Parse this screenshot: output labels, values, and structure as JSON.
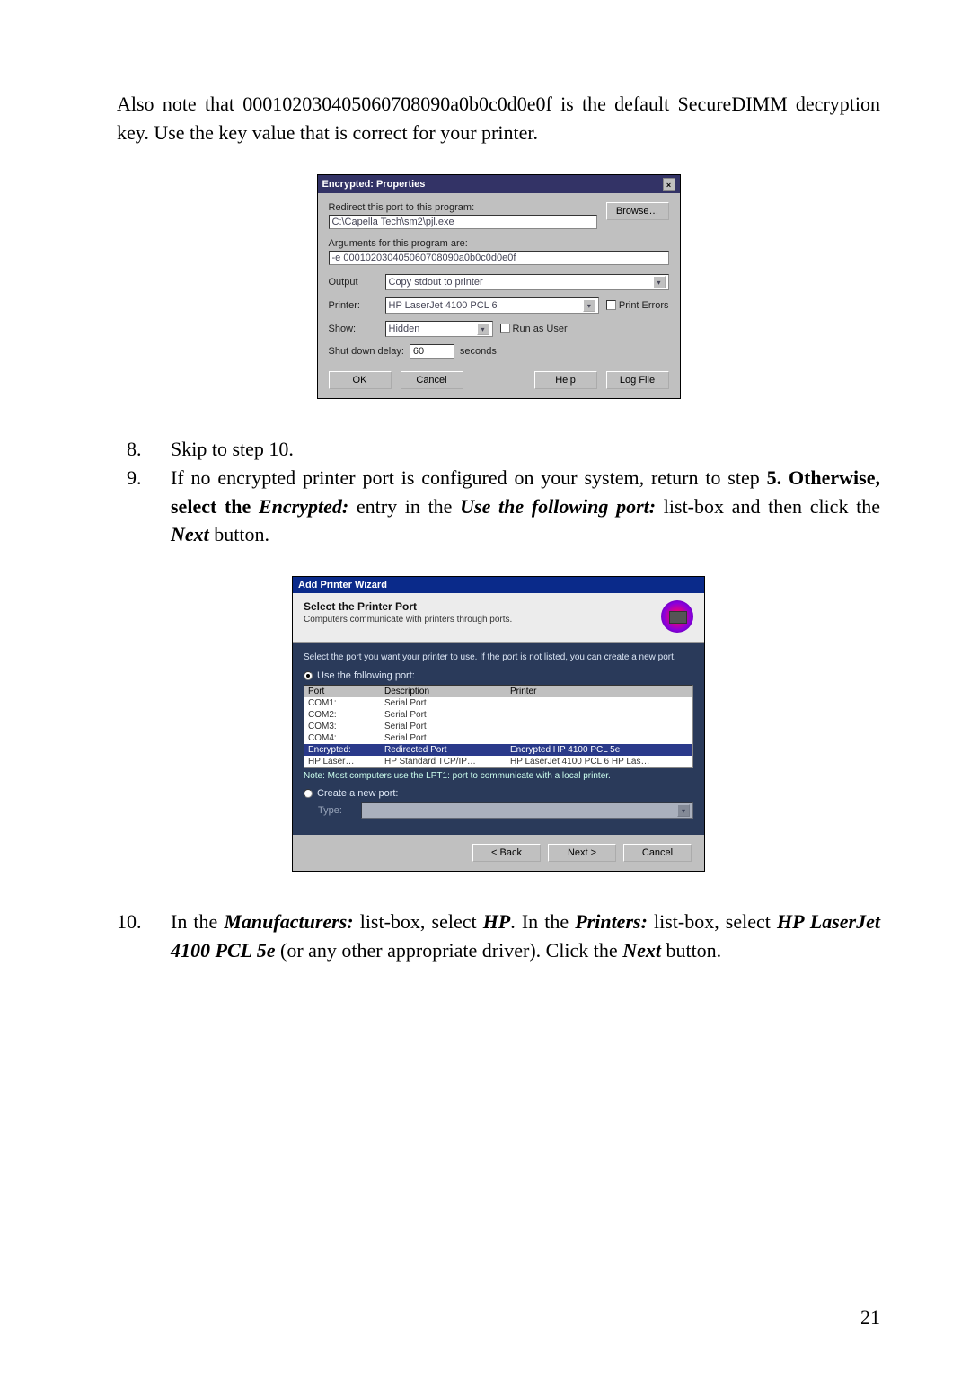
{
  "intro": "Also note that 000102030405060708090a0b0c0d0e0f is the default SecureDIMM decryption key.  Use the key value that is correct for your printer.",
  "dialog1": {
    "title": "Encrypted: Properties",
    "close": "×",
    "redirect_label": "Redirect this port to this program:",
    "redirect_value": "C:\\Capella Tech\\sm2\\pjl.exe",
    "browse": "Browse…",
    "arguments_label": "Arguments for this program are:",
    "arguments_value": "-e 000102030405060708090a0b0c0d0e0f",
    "output_label": "Output",
    "output_value": "Copy stdout to printer",
    "printer_label": "Printer:",
    "printer_value": "HP LaserJet 4100 PCL 6",
    "print_errors_label": "Print Errors",
    "show_label": "Show:",
    "show_value": "Hidden",
    "run_as_user_label": "Run as User",
    "shutdown_label": "Shut down delay:",
    "shutdown_value": "60",
    "shutdown_units": "seconds",
    "ok": "OK",
    "cancel": "Cancel",
    "help": "Help",
    "logfile": "Log File"
  },
  "step8": {
    "num": "8.",
    "text": "Skip to step 10."
  },
  "step9": {
    "num": "9.",
    "text1": "If no encrypted printer port is configured on your system, return to step ",
    "bold5": "5.  Otherwise, select the ",
    "encrypted": "Encrypted:",
    "text2": " entry in the ",
    "usefollowingport": "Use the following port:",
    "text3": " list-box and then click the ",
    "next": "Next",
    "text4": " button."
  },
  "dialog2": {
    "title": "Add Printer Wizard",
    "header_bold": "Select the Printer Port",
    "header_sub": "Computers communicate with printers through ports.",
    "instr": "Select the port you want your printer to use. If the port is not listed, you can create a new port.",
    "use_radio": "Use the following port:",
    "cols": {
      "c1": "Port",
      "c2": "Description",
      "c3": "Printer"
    },
    "rows": [
      {
        "c1": "COM1:",
        "c2": "Serial Port",
        "c3": ""
      },
      {
        "c1": "COM2:",
        "c2": "Serial Port",
        "c3": ""
      },
      {
        "c1": "COM3:",
        "c2": "Serial Port",
        "c3": ""
      },
      {
        "c1": "COM4:",
        "c2": "Serial Port",
        "c3": ""
      },
      {
        "c1": "Encrypted:",
        "c2": "Redirected Port",
        "c3": "Encrypted HP 4100 PCL 5e"
      },
      {
        "c1": "HP Laser…",
        "c2": "HP Standard TCP/IP…",
        "c3": "HP LaserJet 4100 PCL 6 HP Las…"
      }
    ],
    "note": "Note: Most computers use the LPT1: port to communicate with a local printer.",
    "create_radio": "Create a new port:",
    "type_label": "Type:",
    "back": "< Back",
    "next": "Next >",
    "cancel": "Cancel"
  },
  "step10": {
    "num": "10.",
    "text1": "In the ",
    "manufacturers": "Manufacturers:",
    "text2": " list-box, select ",
    "hp": "HP",
    "text3": ".  In the ",
    "printers": "Printers:",
    "text4": " list-box, select ",
    "model": "HP LaserJet 4100 PCL 5e",
    "text5": " (or any other appropriate driver). Click the ",
    "next": "Next",
    "text6": " button."
  },
  "page_number": "21"
}
